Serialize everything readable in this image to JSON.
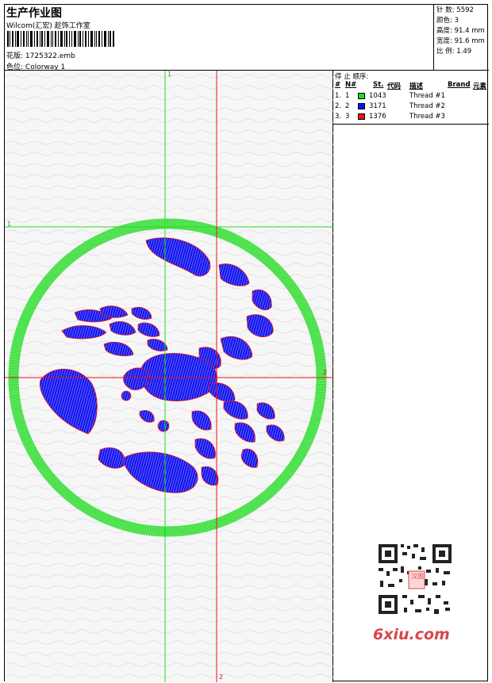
{
  "header": {
    "title": "生产作业图",
    "company": "Wilcom(汇宏) 趁饰工作室",
    "design_label": "花版:",
    "design_value": "1725322.emb",
    "colorway_label": "色位:",
    "colorway_value": "Colorway 1"
  },
  "stats": [
    {
      "label": "针 数:",
      "value": "5592"
    },
    {
      "label": "颜色:",
      "value": "3"
    },
    {
      "label": "高度:",
      "value": "91.4 mm"
    },
    {
      "label": "宽度:",
      "value": "91.6 mm"
    },
    {
      "label": "比 例:",
      "value": "1.49"
    }
  ],
  "stop_sequence": {
    "title": "停 止 顺序:",
    "columns": [
      "#",
      "N#",
      "St.",
      "代码",
      "描述",
      "Brand",
      "元素"
    ],
    "rows": [
      {
        "idx": "1.",
        "n": "1",
        "color": "#22dd22",
        "code": "1043",
        "desc": "Thread #1"
      },
      {
        "idx": "2.",
        "n": "2",
        "color": "#1111ee",
        "code": "3171",
        "desc": "Thread #2"
      },
      {
        "idx": "3.",
        "n": "3",
        "color": "#ee1111",
        "code": "1376",
        "desc": "Thread #3"
      }
    ]
  },
  "guides": {
    "green_label": "1",
    "red_label": "2"
  },
  "watermark": {
    "text": "6xiu.com",
    "stamp": "汉图"
  },
  "colors": {
    "green": "#22dd22",
    "blue": "#1111ee",
    "red": "#ee1111"
  }
}
